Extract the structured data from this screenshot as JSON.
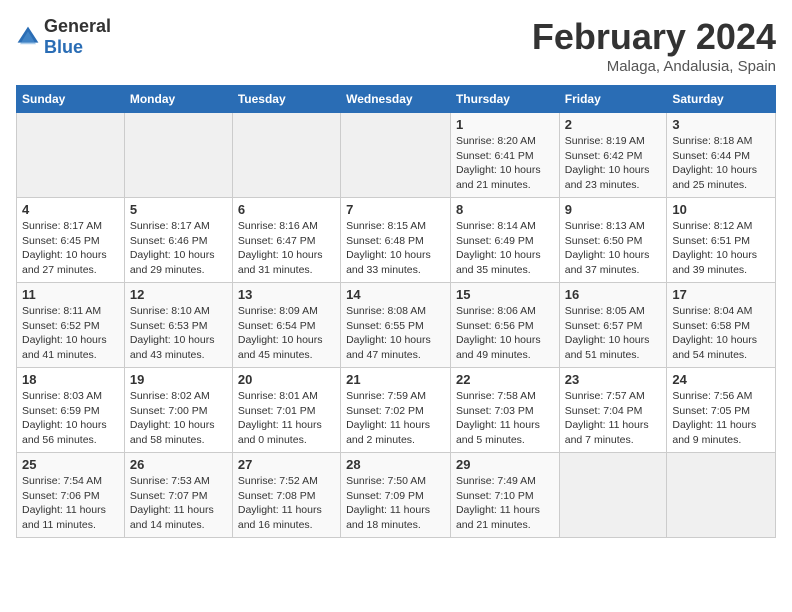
{
  "logo": {
    "general": "General",
    "blue": "Blue"
  },
  "title": "February 2024",
  "location": "Malaga, Andalusia, Spain",
  "weekdays": [
    "Sunday",
    "Monday",
    "Tuesday",
    "Wednesday",
    "Thursday",
    "Friday",
    "Saturday"
  ],
  "weeks": [
    [
      {
        "day": "",
        "details": ""
      },
      {
        "day": "",
        "details": ""
      },
      {
        "day": "",
        "details": ""
      },
      {
        "day": "",
        "details": ""
      },
      {
        "day": "1",
        "details": "Sunrise: 8:20 AM\nSunset: 6:41 PM\nDaylight: 10 hours\nand 21 minutes."
      },
      {
        "day": "2",
        "details": "Sunrise: 8:19 AM\nSunset: 6:42 PM\nDaylight: 10 hours\nand 23 minutes."
      },
      {
        "day": "3",
        "details": "Sunrise: 8:18 AM\nSunset: 6:44 PM\nDaylight: 10 hours\nand 25 minutes."
      }
    ],
    [
      {
        "day": "4",
        "details": "Sunrise: 8:17 AM\nSunset: 6:45 PM\nDaylight: 10 hours\nand 27 minutes."
      },
      {
        "day": "5",
        "details": "Sunrise: 8:17 AM\nSunset: 6:46 PM\nDaylight: 10 hours\nand 29 minutes."
      },
      {
        "day": "6",
        "details": "Sunrise: 8:16 AM\nSunset: 6:47 PM\nDaylight: 10 hours\nand 31 minutes."
      },
      {
        "day": "7",
        "details": "Sunrise: 8:15 AM\nSunset: 6:48 PM\nDaylight: 10 hours\nand 33 minutes."
      },
      {
        "day": "8",
        "details": "Sunrise: 8:14 AM\nSunset: 6:49 PM\nDaylight: 10 hours\nand 35 minutes."
      },
      {
        "day": "9",
        "details": "Sunrise: 8:13 AM\nSunset: 6:50 PM\nDaylight: 10 hours\nand 37 minutes."
      },
      {
        "day": "10",
        "details": "Sunrise: 8:12 AM\nSunset: 6:51 PM\nDaylight: 10 hours\nand 39 minutes."
      }
    ],
    [
      {
        "day": "11",
        "details": "Sunrise: 8:11 AM\nSunset: 6:52 PM\nDaylight: 10 hours\nand 41 minutes."
      },
      {
        "day": "12",
        "details": "Sunrise: 8:10 AM\nSunset: 6:53 PM\nDaylight: 10 hours\nand 43 minutes."
      },
      {
        "day": "13",
        "details": "Sunrise: 8:09 AM\nSunset: 6:54 PM\nDaylight: 10 hours\nand 45 minutes."
      },
      {
        "day": "14",
        "details": "Sunrise: 8:08 AM\nSunset: 6:55 PM\nDaylight: 10 hours\nand 47 minutes."
      },
      {
        "day": "15",
        "details": "Sunrise: 8:06 AM\nSunset: 6:56 PM\nDaylight: 10 hours\nand 49 minutes."
      },
      {
        "day": "16",
        "details": "Sunrise: 8:05 AM\nSunset: 6:57 PM\nDaylight: 10 hours\nand 51 minutes."
      },
      {
        "day": "17",
        "details": "Sunrise: 8:04 AM\nSunset: 6:58 PM\nDaylight: 10 hours\nand 54 minutes."
      }
    ],
    [
      {
        "day": "18",
        "details": "Sunrise: 8:03 AM\nSunset: 6:59 PM\nDaylight: 10 hours\nand 56 minutes."
      },
      {
        "day": "19",
        "details": "Sunrise: 8:02 AM\nSunset: 7:00 PM\nDaylight: 10 hours\nand 58 minutes."
      },
      {
        "day": "20",
        "details": "Sunrise: 8:01 AM\nSunset: 7:01 PM\nDaylight: 11 hours\nand 0 minutes."
      },
      {
        "day": "21",
        "details": "Sunrise: 7:59 AM\nSunset: 7:02 PM\nDaylight: 11 hours\nand 2 minutes."
      },
      {
        "day": "22",
        "details": "Sunrise: 7:58 AM\nSunset: 7:03 PM\nDaylight: 11 hours\nand 5 minutes."
      },
      {
        "day": "23",
        "details": "Sunrise: 7:57 AM\nSunset: 7:04 PM\nDaylight: 11 hours\nand 7 minutes."
      },
      {
        "day": "24",
        "details": "Sunrise: 7:56 AM\nSunset: 7:05 PM\nDaylight: 11 hours\nand 9 minutes."
      }
    ],
    [
      {
        "day": "25",
        "details": "Sunrise: 7:54 AM\nSunset: 7:06 PM\nDaylight: 11 hours\nand 11 minutes."
      },
      {
        "day": "26",
        "details": "Sunrise: 7:53 AM\nSunset: 7:07 PM\nDaylight: 11 hours\nand 14 minutes."
      },
      {
        "day": "27",
        "details": "Sunrise: 7:52 AM\nSunset: 7:08 PM\nDaylight: 11 hours\nand 16 minutes."
      },
      {
        "day": "28",
        "details": "Sunrise: 7:50 AM\nSunset: 7:09 PM\nDaylight: 11 hours\nand 18 minutes."
      },
      {
        "day": "29",
        "details": "Sunrise: 7:49 AM\nSunset: 7:10 PM\nDaylight: 11 hours\nand 21 minutes."
      },
      {
        "day": "",
        "details": ""
      },
      {
        "day": "",
        "details": ""
      }
    ]
  ]
}
